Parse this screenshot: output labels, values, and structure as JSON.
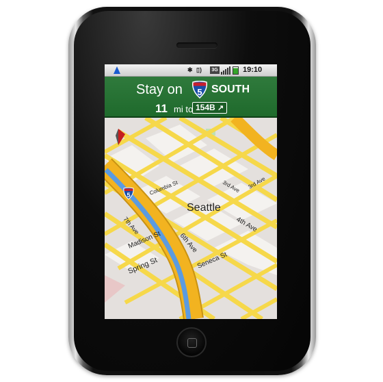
{
  "status_bar": {
    "bluetooth_icon": "bluetooth-icon",
    "vibrate_icon": "vibrate-icon",
    "network": "3G",
    "time": "19:10"
  },
  "banner": {
    "instruction": "Stay on",
    "route_shield": "5",
    "direction": "SOUTH",
    "distance": "11",
    "distance_unit": "mi to",
    "exit": "154B",
    "exit_arrow": "↗"
  },
  "map": {
    "city": "Seattle",
    "interstate_shield": "5",
    "streets": {
      "columbia": "Columbia St",
      "third_ave": "3rd Ave",
      "fourth_ave": "4th Ave",
      "seventh_ave": "7th Ave",
      "madison": "Madison St",
      "sixth_ave": "6th Ave",
      "spring": "Spring St",
      "seneca": "Seneca St"
    },
    "colors": {
      "street": "#f6d84a",
      "freeway": "#f2b320",
      "route": "#5b9be0",
      "block": "#f3f1ee",
      "ground": "#e2dedb"
    }
  }
}
